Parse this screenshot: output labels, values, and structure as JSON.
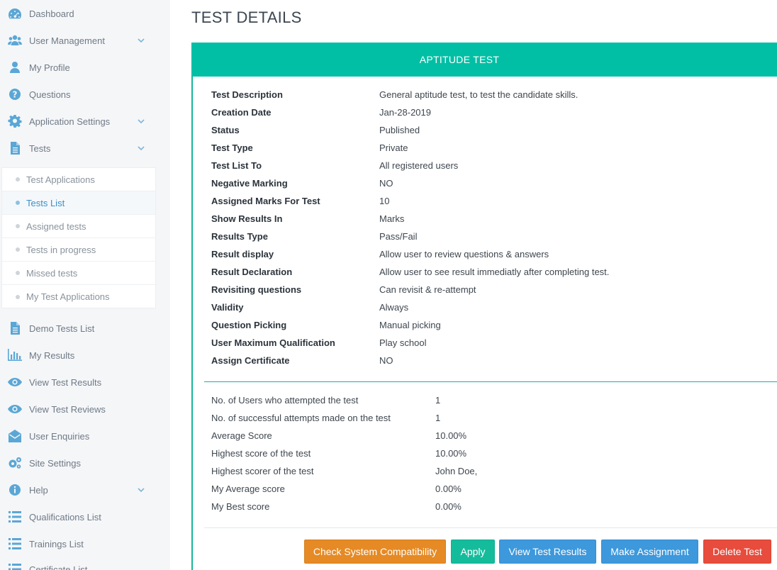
{
  "sidebar": {
    "items": [
      {
        "label": "Dashboard",
        "icon": "dashboard-icon"
      },
      {
        "label": "User Management",
        "icon": "users-icon",
        "expandable": true
      },
      {
        "label": "My Profile",
        "icon": "user-icon"
      },
      {
        "label": "Questions",
        "icon": "question-circle-icon"
      },
      {
        "label": "Application Settings",
        "icon": "gear-icon",
        "expandable": true
      },
      {
        "label": "Tests",
        "icon": "file-icon",
        "expandable": true
      }
    ],
    "tests_submenu": [
      {
        "label": "Test Applications"
      },
      {
        "label": "Tests List",
        "active": true
      },
      {
        "label": "Assigned tests"
      },
      {
        "label": "Tests in progress"
      },
      {
        "label": "Missed tests"
      },
      {
        "label": "My Test Applications"
      }
    ],
    "items_after": [
      {
        "label": "Demo Tests List",
        "icon": "file-icon"
      },
      {
        "label": "My Results",
        "icon": "bar-chart-icon"
      },
      {
        "label": "View Test Results",
        "icon": "eye-icon"
      },
      {
        "label": "View Test Reviews",
        "icon": "eye-icon"
      },
      {
        "label": "User Enquiries",
        "icon": "envelope-open-icon"
      },
      {
        "label": "Site Settings",
        "icon": "gears-icon"
      },
      {
        "label": "Help",
        "icon": "info-circle-icon",
        "expandable": true
      },
      {
        "label": "Qualifications List",
        "icon": "list-icon"
      },
      {
        "label": "Trainings List",
        "icon": "list-icon"
      },
      {
        "label": "Certificate List",
        "icon": "list-icon"
      }
    ]
  },
  "page": {
    "title": "TEST DETAILS"
  },
  "panel": {
    "header": "APTITUDE TEST",
    "details": [
      {
        "key": "Test Description",
        "value": "General aptitude test, to test the candidate skills."
      },
      {
        "key": "Creation Date",
        "value": "Jan-28-2019"
      },
      {
        "key": "Status",
        "value": "Published"
      },
      {
        "key": "Test Type",
        "value": "Private"
      },
      {
        "key": "Test List To",
        "value": "All registered users"
      },
      {
        "key": "Negative Marking",
        "value": "NO"
      },
      {
        "key": "Assigned Marks For Test",
        "value": "10"
      },
      {
        "key": "Show Results In",
        "value": "Marks"
      },
      {
        "key": "Results Type",
        "value": "Pass/Fail"
      },
      {
        "key": "Result display",
        "value": "Allow user to review questions & answers"
      },
      {
        "key": "Result Declaration",
        "value": "Allow user to see result immediatly after completing test."
      },
      {
        "key": "Revisiting questions",
        "value": "Can revisit & re-attempt"
      },
      {
        "key": "Validity",
        "value": "Always"
      },
      {
        "key": "Question Picking",
        "value": "Manual picking"
      },
      {
        "key": "User Maximum Qualification",
        "value": "Play school"
      },
      {
        "key": "Assign Certificate",
        "value": "NO"
      }
    ],
    "stats": [
      {
        "key": "No. of Users who attempted the test",
        "value": "1"
      },
      {
        "key": "No. of successful attempts made on the test",
        "value": "1"
      },
      {
        "key": "Average Score",
        "value": "10.00%"
      },
      {
        "key": "Highest score of the test",
        "value": "10.00%"
      },
      {
        "key": "Highest scorer of the test",
        "value": "John Doe,"
      },
      {
        "key": "My Average score",
        "value": "0.00%"
      },
      {
        "key": "My Best score",
        "value": "0.00%"
      }
    ]
  },
  "buttons": {
    "check_compat": "Check System Compatibility",
    "apply": "Apply",
    "view_results": "View Test Results",
    "make_assignment": "Make Assignment",
    "delete_test": "Delete Test"
  },
  "colors": {
    "accent": "#00bfa5",
    "orange": "#e58a24",
    "blue": "#3d98dc",
    "red": "#e74c3c",
    "sidebar_icon": "#5aa7d6"
  }
}
